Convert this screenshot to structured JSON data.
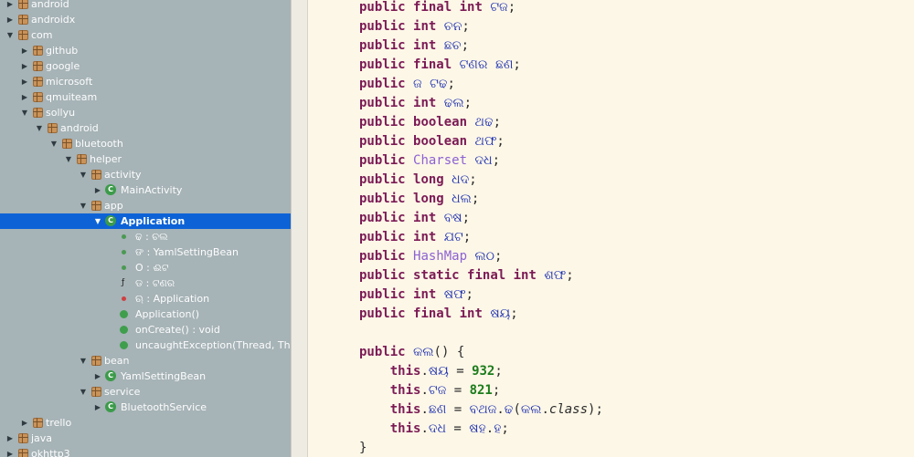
{
  "tree": {
    "rows": [
      {
        "label": "android",
        "arrow": "▶",
        "icon": "package",
        "indent": 0
      },
      {
        "label": "androidx",
        "arrow": "▶",
        "icon": "package",
        "indent": 0
      },
      {
        "label": "com",
        "arrow": "▼",
        "icon": "package",
        "indent": 0
      },
      {
        "label": "github",
        "arrow": "▶",
        "icon": "package",
        "indent": 1
      },
      {
        "label": "google",
        "arrow": "▶",
        "icon": "package",
        "indent": 1
      },
      {
        "label": "microsoft",
        "arrow": "▶",
        "icon": "package",
        "indent": 1
      },
      {
        "label": "qmuiteam",
        "arrow": "▶",
        "icon": "package",
        "indent": 1
      },
      {
        "label": "sollyu",
        "arrow": "▼",
        "icon": "package",
        "indent": 1
      },
      {
        "label": "android",
        "arrow": "▼",
        "icon": "package",
        "indent": 2
      },
      {
        "label": "bluetooth",
        "arrow": "▼",
        "icon": "package",
        "indent": 3
      },
      {
        "label": "helper",
        "arrow": "▼",
        "icon": "package",
        "indent": 4
      },
      {
        "label": "activity",
        "arrow": "▼",
        "icon": "package",
        "indent": 5
      },
      {
        "label": "MainActivity",
        "arrow": "▶",
        "icon": "class",
        "indent": 6
      },
      {
        "label": "app",
        "arrow": "▼",
        "icon": "package",
        "indent": 5
      },
      {
        "label": "Application",
        "arrow": "▼",
        "icon": "class",
        "indent": 6,
        "selected": true
      },
      {
        "label": "ଢ : ଚଲ",
        "arrow": "",
        "icon": "field",
        "indent": 7
      },
      {
        "label": "ଙ : YamlSettingBean",
        "arrow": "",
        "icon": "field",
        "indent": 7
      },
      {
        "label": "Ο : ଈଟ",
        "arrow": "",
        "icon": "field",
        "indent": 7
      },
      {
        "label": "ଡ : ଟଣର",
        "arrow": "",
        "icon": "field-final",
        "indent": 7
      },
      {
        "label": "ଋ : Application",
        "arrow": "",
        "icon": "field-static",
        "indent": 7
      },
      {
        "label": "Application()",
        "arrow": "",
        "icon": "method",
        "indent": 7
      },
      {
        "label": "onCreate() : void",
        "arrow": "",
        "icon": "method",
        "indent": 7
      },
      {
        "label": "uncaughtException(Thread, Thro",
        "arrow": "",
        "icon": "method",
        "indent": 7
      },
      {
        "label": "bean",
        "arrow": "▼",
        "icon": "package",
        "indent": 5
      },
      {
        "label": "YamlSettingBean",
        "arrow": "▶",
        "icon": "class",
        "indent": 6
      },
      {
        "label": "service",
        "arrow": "▼",
        "icon": "package",
        "indent": 5
      },
      {
        "label": "BluetoothService",
        "arrow": "▶",
        "icon": "class",
        "indent": 6
      },
      {
        "label": "trello",
        "arrow": "▶",
        "icon": "package",
        "indent": 1
      },
      {
        "label": "java",
        "arrow": "▶",
        "icon": "package",
        "indent": 0
      },
      {
        "label": "okhttp3",
        "arrow": "▶",
        "icon": "package",
        "indent": 0
      }
    ]
  },
  "code": {
    "lines": [
      [
        {
          "t": "public",
          "c": "kw"
        },
        {
          "t": " "
        },
        {
          "t": "final",
          "c": "kw"
        },
        {
          "t": " "
        },
        {
          "t": "int",
          "c": "kw"
        },
        {
          "t": " "
        },
        {
          "t": "ଟଜ",
          "c": "nm"
        },
        {
          "t": ";"
        }
      ],
      [
        {
          "t": "public",
          "c": "kw"
        },
        {
          "t": " "
        },
        {
          "t": "int",
          "c": "kw"
        },
        {
          "t": " "
        },
        {
          "t": "ଚନ",
          "c": "nm"
        },
        {
          "t": ";"
        }
      ],
      [
        {
          "t": "public",
          "c": "kw"
        },
        {
          "t": " "
        },
        {
          "t": "int",
          "c": "kw"
        },
        {
          "t": " "
        },
        {
          "t": "ଛଚ",
          "c": "nm"
        },
        {
          "t": ";"
        }
      ],
      [
        {
          "t": "public",
          "c": "kw"
        },
        {
          "t": " "
        },
        {
          "t": "final",
          "c": "kw"
        },
        {
          "t": " "
        },
        {
          "t": "ଟଣର",
          "c": "nm"
        },
        {
          "t": " "
        },
        {
          "t": "ଛଣ",
          "c": "nm"
        },
        {
          "t": ";"
        }
      ],
      [
        {
          "t": "public",
          "c": "kw"
        },
        {
          "t": " "
        },
        {
          "t": "ଜ",
          "c": "nm"
        },
        {
          "t": " "
        },
        {
          "t": "ଟଢ",
          "c": "nm"
        },
        {
          "t": ";"
        }
      ],
      [
        {
          "t": "public",
          "c": "kw"
        },
        {
          "t": " "
        },
        {
          "t": "int",
          "c": "kw"
        },
        {
          "t": " "
        },
        {
          "t": "ଢଲ",
          "c": "nm"
        },
        {
          "t": ";"
        }
      ],
      [
        {
          "t": "public",
          "c": "kw"
        },
        {
          "t": " "
        },
        {
          "t": "boolean",
          "c": "kw"
        },
        {
          "t": " "
        },
        {
          "t": "ଥଢ",
          "c": "nm"
        },
        {
          "t": ";"
        }
      ],
      [
        {
          "t": "public",
          "c": "kw"
        },
        {
          "t": " "
        },
        {
          "t": "boolean",
          "c": "kw"
        },
        {
          "t": " "
        },
        {
          "t": "ଥଫ",
          "c": "nm"
        },
        {
          "t": ";"
        }
      ],
      [
        {
          "t": "public",
          "c": "kw"
        },
        {
          "t": " "
        },
        {
          "t": "Charset",
          "c": "ty"
        },
        {
          "t": " "
        },
        {
          "t": "ଦଧ",
          "c": "nm"
        },
        {
          "t": ";"
        }
      ],
      [
        {
          "t": "public",
          "c": "kw"
        },
        {
          "t": " "
        },
        {
          "t": "long",
          "c": "kw"
        },
        {
          "t": " "
        },
        {
          "t": "ଧଦ",
          "c": "nm"
        },
        {
          "t": ";"
        }
      ],
      [
        {
          "t": "public",
          "c": "kw"
        },
        {
          "t": " "
        },
        {
          "t": "long",
          "c": "kw"
        },
        {
          "t": " "
        },
        {
          "t": "ଧଲ",
          "c": "nm"
        },
        {
          "t": ";"
        }
      ],
      [
        {
          "t": "public",
          "c": "kw"
        },
        {
          "t": " "
        },
        {
          "t": "int",
          "c": "kw"
        },
        {
          "t": " "
        },
        {
          "t": "ବଷ",
          "c": "nm"
        },
        {
          "t": ";"
        }
      ],
      [
        {
          "t": "public",
          "c": "kw"
        },
        {
          "t": " "
        },
        {
          "t": "int",
          "c": "kw"
        },
        {
          "t": " "
        },
        {
          "t": "ଯଟ",
          "c": "nm"
        },
        {
          "t": ";"
        }
      ],
      [
        {
          "t": "public",
          "c": "kw"
        },
        {
          "t": " "
        },
        {
          "t": "HashMap",
          "c": "ty"
        },
        {
          "t": " "
        },
        {
          "t": "ଲଠ",
          "c": "nm"
        },
        {
          "t": ";"
        }
      ],
      [
        {
          "t": "public",
          "c": "kw"
        },
        {
          "t": " "
        },
        {
          "t": "static",
          "c": "kw"
        },
        {
          "t": " "
        },
        {
          "t": "final",
          "c": "kw"
        },
        {
          "t": " "
        },
        {
          "t": "int",
          "c": "kw"
        },
        {
          "t": " "
        },
        {
          "t": "ଶଫ",
          "c": "nm"
        },
        {
          "t": ";"
        }
      ],
      [
        {
          "t": "public",
          "c": "kw"
        },
        {
          "t": " "
        },
        {
          "t": "int",
          "c": "kw"
        },
        {
          "t": " "
        },
        {
          "t": "ଷଫ",
          "c": "nm"
        },
        {
          "t": ";"
        }
      ],
      [
        {
          "t": "public",
          "c": "kw"
        },
        {
          "t": " "
        },
        {
          "t": "final",
          "c": "kw"
        },
        {
          "t": " "
        },
        {
          "t": "int",
          "c": "kw"
        },
        {
          "t": " "
        },
        {
          "t": "ଷୟ",
          "c": "nm"
        },
        {
          "t": ";"
        }
      ],
      [],
      [
        {
          "t": "public",
          "c": "kw"
        },
        {
          "t": " "
        },
        {
          "t": "କଲ",
          "c": "nm"
        },
        {
          "t": "() {"
        }
      ],
      [
        {
          "t": "    "
        },
        {
          "t": "this",
          "c": "kw"
        },
        {
          "t": "."
        },
        {
          "t": "ଷୟ",
          "c": "nm"
        },
        {
          "t": " = "
        },
        {
          "t": "932",
          "c": "num"
        },
        {
          "t": ";"
        }
      ],
      [
        {
          "t": "    "
        },
        {
          "t": "this",
          "c": "kw"
        },
        {
          "t": "."
        },
        {
          "t": "ଟଜ",
          "c": "nm"
        },
        {
          "t": " = "
        },
        {
          "t": "821",
          "c": "num"
        },
        {
          "t": ";"
        }
      ],
      [
        {
          "t": "    "
        },
        {
          "t": "this",
          "c": "kw"
        },
        {
          "t": "."
        },
        {
          "t": "ଛଣ",
          "c": "nm"
        },
        {
          "t": " = "
        },
        {
          "t": "ବଥଜ",
          "c": "nm"
        },
        {
          "t": "."
        },
        {
          "t": "ଢ",
          "c": "nm"
        },
        {
          "t": "("
        },
        {
          "t": "କଲ",
          "c": "nm"
        },
        {
          "t": "."
        },
        {
          "t": "class",
          "c": "it"
        },
        {
          "t": ");"
        }
      ],
      [
        {
          "t": "    "
        },
        {
          "t": "this",
          "c": "kw"
        },
        {
          "t": "."
        },
        {
          "t": "ଦଧ",
          "c": "nm"
        },
        {
          "t": " = "
        },
        {
          "t": "ଷହ",
          "c": "nm"
        },
        {
          "t": "."
        },
        {
          "t": "ହ",
          "c": "nm"
        },
        {
          "t": ";"
        }
      ],
      [
        {
          "t": "}"
        }
      ]
    ]
  }
}
